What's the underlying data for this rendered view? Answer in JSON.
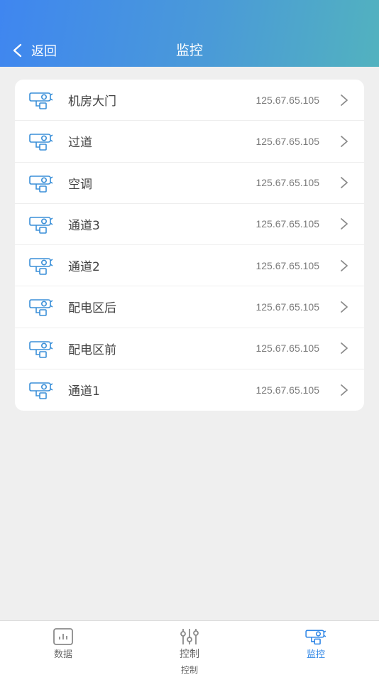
{
  "header": {
    "back_label": "返回",
    "title": "监控"
  },
  "cameras": [
    {
      "name": "机房大门",
      "ip": "125.67.65.105"
    },
    {
      "name": "过道",
      "ip": "125.67.65.105"
    },
    {
      "name": "空调",
      "ip": "125.67.65.105"
    },
    {
      "name": "通道3",
      "ip": "125.67.65.105"
    },
    {
      "name": "通道2",
      "ip": "125.67.65.105"
    },
    {
      "name": "配电区后",
      "ip": "125.67.65.105"
    },
    {
      "name": "配电区前",
      "ip": "125.67.65.105"
    },
    {
      "name": "通道1",
      "ip": "125.67.65.105"
    }
  ],
  "tabbar": {
    "tabs": [
      {
        "label": "数据",
        "icon": "bar-chart-icon",
        "active": false
      },
      {
        "label": "控制",
        "icon": "sliders-icon",
        "active": false,
        "sub_label": "控制"
      },
      {
        "label": "监控",
        "icon": "camera-icon",
        "active": true
      }
    ]
  },
  "colors": {
    "header_start": "#3f86f0",
    "header_end": "#52b2bf",
    "accent": "#2f86e6",
    "icon_blue": "#3a8fd8"
  }
}
